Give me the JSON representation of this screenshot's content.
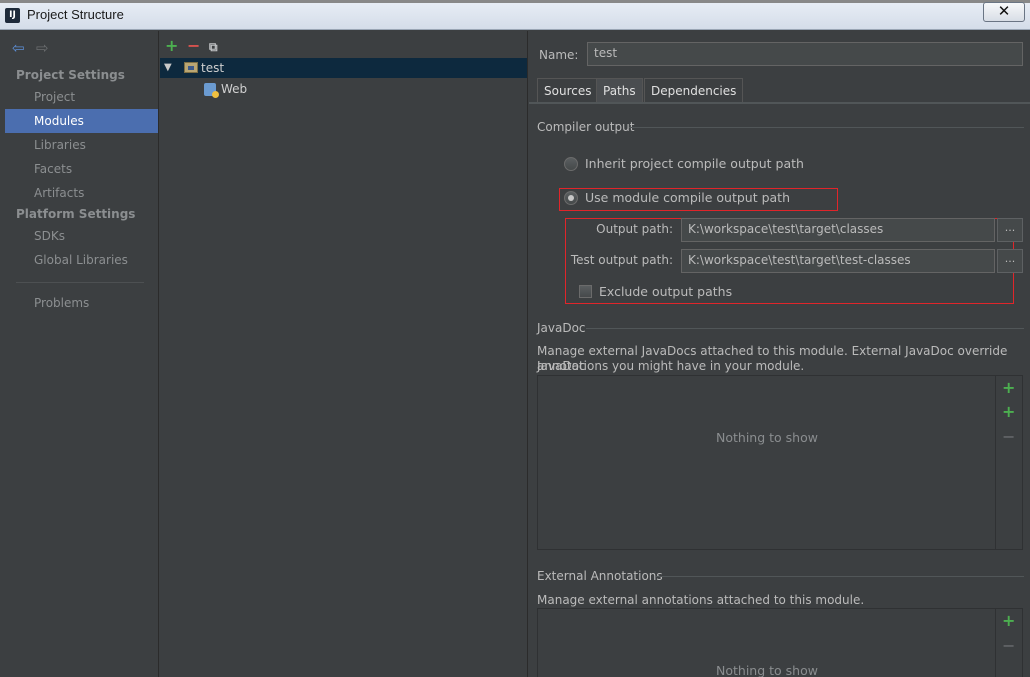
{
  "window": {
    "title": "Project Structure",
    "close_glyph": "✕"
  },
  "sidebar": {
    "project_settings_header": "Project Settings",
    "platform_settings_header": "Platform Settings",
    "items": [
      {
        "label": "Project"
      },
      {
        "label": "Modules",
        "selected": true
      },
      {
        "label": "Libraries"
      },
      {
        "label": "Facets"
      },
      {
        "label": "Artifacts"
      },
      {
        "label": "SDKs"
      },
      {
        "label": "Global Libraries"
      },
      {
        "label": "Problems"
      }
    ]
  },
  "tree": {
    "nodes": [
      {
        "label": "test",
        "type": "module",
        "expanded": true,
        "selected": true
      },
      {
        "label": "Web",
        "type": "facet"
      }
    ]
  },
  "module": {
    "name_label": "Name:",
    "name_value": "test",
    "tabs": [
      {
        "label": "Sources"
      },
      {
        "label": "Paths",
        "active": true
      },
      {
        "label": "Dependencies"
      }
    ],
    "compiler_output": {
      "title": "Compiler output",
      "inherit_label": "Inherit project compile output path",
      "use_module_label": "Use module compile output path",
      "selected": "use_module",
      "output_path_label": "Output path:",
      "output_path_value": "K:\\workspace\\test\\target\\classes",
      "test_output_path_label": "Test output path:",
      "test_output_path_value": "K:\\workspace\\test\\target\\test-classes",
      "exclude_label": "Exclude output paths",
      "exclude_checked": false,
      "browse_glyph": "..."
    },
    "javadoc": {
      "title": "JavaDoc",
      "description_line1": "Manage external JavaDocs attached to this module. External JavaDoc override JavaDoc",
      "description_line2": "annotations you might have in your module.",
      "empty_text": "Nothing to show"
    },
    "external_annotations": {
      "title": "External Annotations",
      "description": "Manage external annotations attached to this module.",
      "empty_text": "Nothing to show"
    }
  },
  "colors": {
    "background": "#3c3f41",
    "selection": "#4b6eaf",
    "tree_selection": "#0d293e",
    "highlight_box": "#e0252a",
    "add": "#4caf50",
    "remove": "#d9534f"
  }
}
